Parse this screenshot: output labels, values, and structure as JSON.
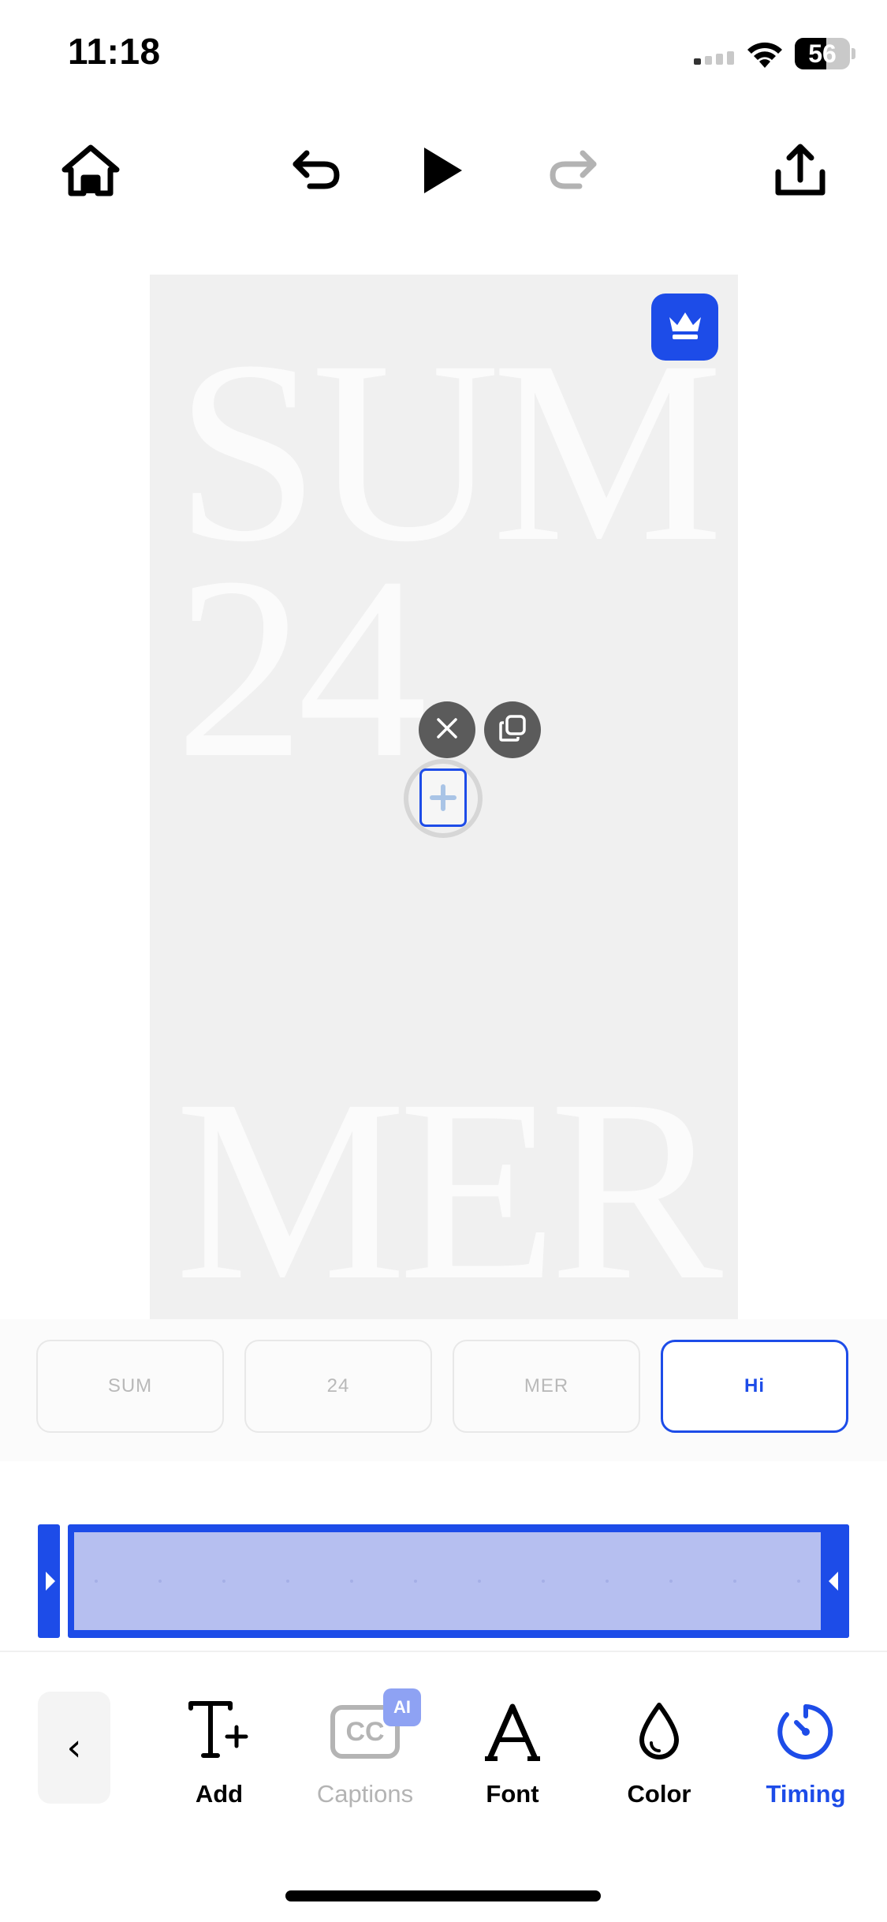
{
  "status_bar": {
    "time": "11:18",
    "battery_level": "56",
    "icons": [
      "cellular-signal-icon",
      "wifi-icon",
      "battery-icon"
    ]
  },
  "toolbar": {
    "icons": [
      "home-icon",
      "undo-icon",
      "play-icon",
      "redo-icon",
      "share-icon"
    ],
    "redo_enabled": false
  },
  "canvas": {
    "text_line_1": "SUM",
    "text_line_2": "24",
    "text_line_3": "MER",
    "premium_icon": "crown-icon",
    "selection_actions": [
      "close-icon",
      "duplicate-icon"
    ]
  },
  "text_chips": [
    {
      "label": "SUM",
      "active": false
    },
    {
      "label": "24",
      "active": false
    },
    {
      "label": "MER",
      "active": false
    },
    {
      "label": "Hi",
      "active": true
    }
  ],
  "bottom_tools": {
    "back_label": "‹",
    "items": [
      {
        "label": "Add",
        "icon": "text-add-icon",
        "state": "normal"
      },
      {
        "label": "Captions",
        "icon": "captions-icon",
        "badge": "AI",
        "state": "disabled"
      },
      {
        "label": "Font",
        "icon": "font-icon",
        "state": "normal"
      },
      {
        "label": "Color",
        "icon": "color-drop-icon",
        "state": "normal"
      },
      {
        "label": "Timing",
        "icon": "timing-icon",
        "state": "selected"
      }
    ]
  },
  "colors": {
    "accent": "#1d4ce8",
    "canvas_bg": "#f0f0f0",
    "timeline_fill": "#b6bff0"
  }
}
